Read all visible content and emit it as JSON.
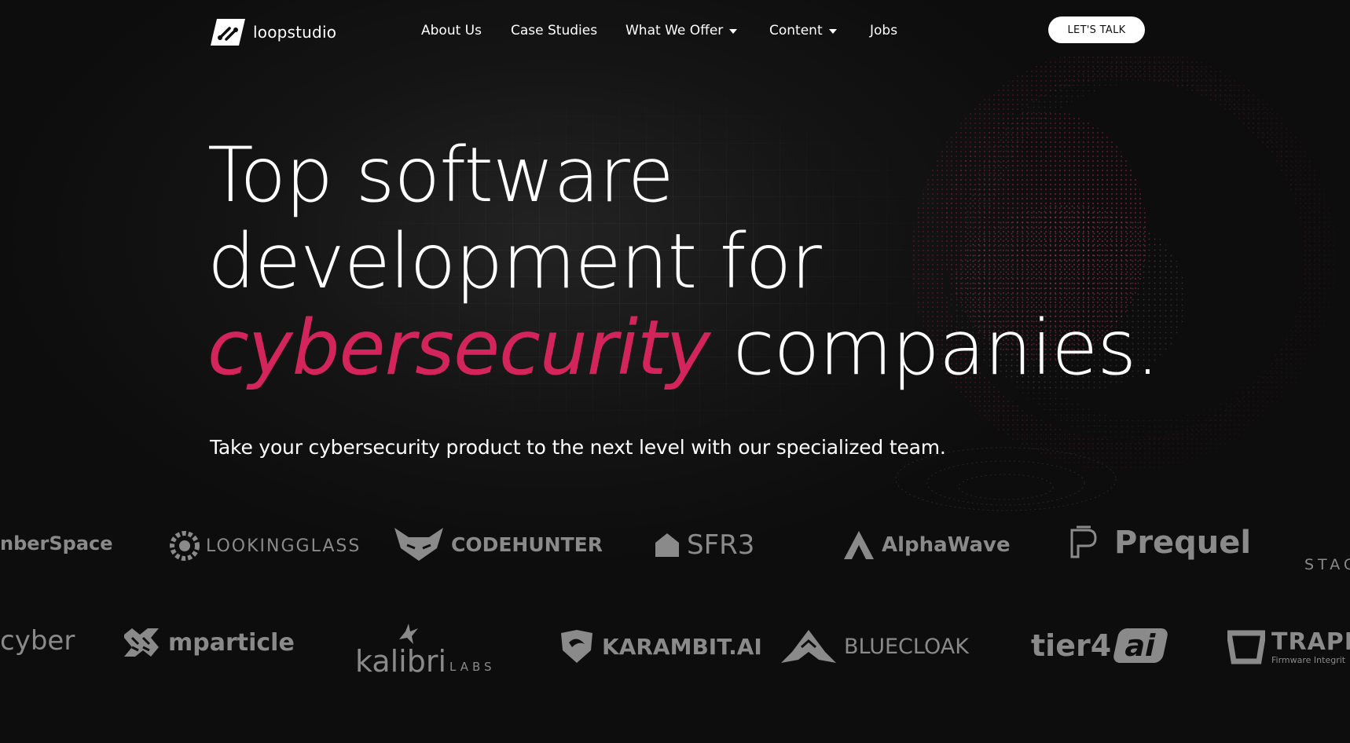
{
  "header": {
    "logo_text": "loopstudio",
    "nav": [
      {
        "label": "About Us",
        "dropdown": false
      },
      {
        "label": "Case Studies",
        "dropdown": false
      },
      {
        "label": "What We Offer",
        "dropdown": true
      },
      {
        "label": "Content",
        "dropdown": true
      },
      {
        "label": "Jobs",
        "dropdown": false
      }
    ],
    "cta_label": "LET'S TALK"
  },
  "hero": {
    "line1": "Top software",
    "line2": "development for",
    "line3_accent": "cybersecurity",
    "line3_rest": " companies.",
    "subtitle": "Take your cybersecurity product to the next level with our specialized team."
  },
  "clients_row1": [
    "nberSpace",
    "LOOKINGGLASS",
    "CODEHUNTER",
    "SFR3",
    "AlphaWave",
    "Prequel",
    "STAC"
  ],
  "clients_row2": [
    "cyber",
    "mparticle",
    "kalibri",
    "LABS",
    "KARAMBIT.AI",
    "BLUECLOAK",
    "tier4",
    "ai",
    "TRAPE",
    "Firmware Integrit"
  ],
  "colors": {
    "accent": "#d4245c",
    "background": "#0d0d0d",
    "logo_gray": "#8a8a8a"
  }
}
